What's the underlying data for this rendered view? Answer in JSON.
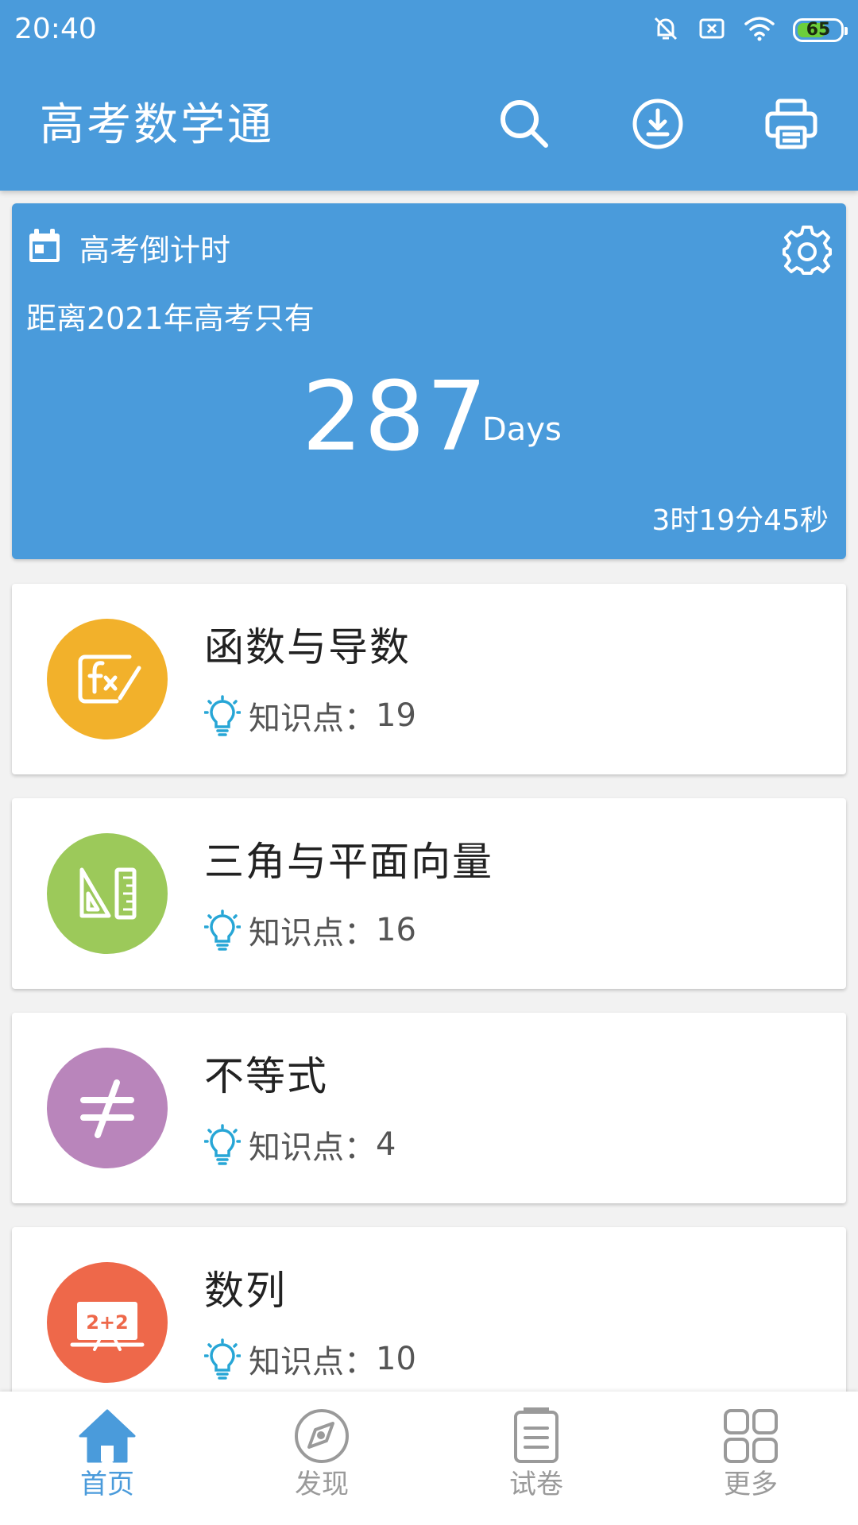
{
  "status_bar": {
    "time": "20:40",
    "battery": "65",
    "icons": [
      "notifications-muted-icon",
      "sim-card-icon",
      "wifi-icon",
      "battery-icon"
    ]
  },
  "app_bar": {
    "title": "高考数学通",
    "actions": [
      "search-icon",
      "download-icon",
      "print-icon"
    ]
  },
  "countdown": {
    "title": "高考倒计时",
    "subtitle": "距离2021年高考只有",
    "days": "287",
    "days_unit": "Days",
    "time_left": "3时19分45秒"
  },
  "topics": [
    {
      "title": "函数与导数",
      "meta_label": "知识点：",
      "count": "19",
      "color": "#f2b12b",
      "icon": "function-fx-icon"
    },
    {
      "title": "三角与平面向量",
      "meta_label": "知识点：",
      "count": "16",
      "color": "#9cc95a",
      "icon": "triangle-ruler-icon"
    },
    {
      "title": "不等式",
      "meta_label": "知识点：",
      "count": "4",
      "color": "#b985bb",
      "icon": "not-equal-icon"
    },
    {
      "title": "数列",
      "meta_label": "知识点：",
      "count": "10",
      "color": "#ee684a",
      "icon": "blackboard-icon"
    }
  ],
  "bottom_nav": [
    {
      "label": "首页",
      "icon": "home-icon",
      "active": true
    },
    {
      "label": "发现",
      "icon": "compass-icon",
      "active": false
    },
    {
      "label": "试卷",
      "icon": "document-icon",
      "active": false
    },
    {
      "label": "更多",
      "icon": "grid-icon",
      "active": false
    }
  ],
  "colors": {
    "primary": "#4a9bdb",
    "bulb": "#27a6d6",
    "nav_inactive": "#9a9a9a"
  }
}
